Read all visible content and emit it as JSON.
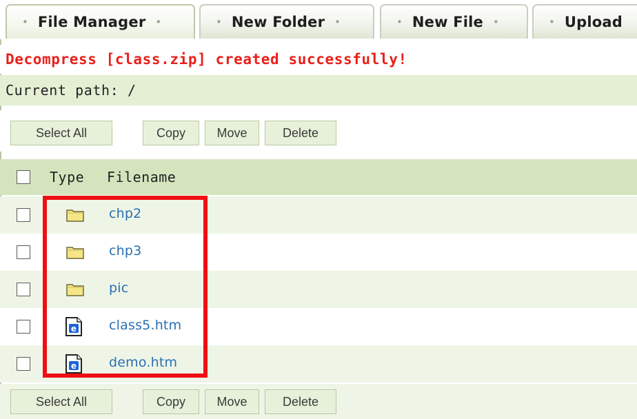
{
  "tabs": [
    {
      "label": "File Manager",
      "active": true
    },
    {
      "label": "New Folder",
      "active": false
    },
    {
      "label": "New File",
      "active": false
    },
    {
      "label": "Upload",
      "active": false
    }
  ],
  "message": "Decompress [class.zip] created successfully!",
  "current_path": "Current path: /",
  "actions": {
    "select_all": "Select All",
    "copy": "Copy",
    "move": "Move",
    "delete": "Delete"
  },
  "table": {
    "headers": {
      "type": "Type",
      "filename": "Filename"
    },
    "rows": [
      {
        "name": "chp2",
        "type": "folder-icon"
      },
      {
        "name": "chp3",
        "type": "folder-icon"
      },
      {
        "name": "pic",
        "type": "folder-icon"
      },
      {
        "name": "class5.htm",
        "type": "htm-file-icon"
      },
      {
        "name": "demo.htm",
        "type": "htm-file-icon"
      }
    ]
  },
  "colors": {
    "message": "#e8201a",
    "link": "#2a6fb2",
    "header_bg": "#d4e5be",
    "row_alt_bg": "#eef5e6",
    "highlight": "#ee0f12"
  }
}
